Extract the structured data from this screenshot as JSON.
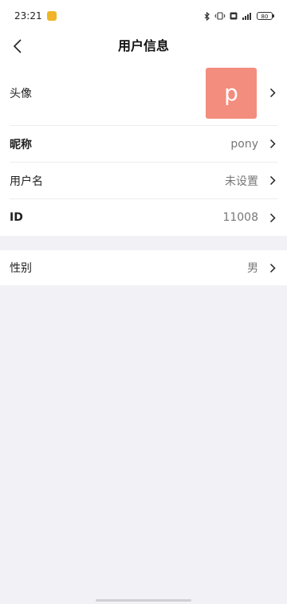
{
  "status_bar": {
    "time": "23:21",
    "notification_icon": "app-notification-icon",
    "battery": "80",
    "icons": [
      "bluetooth-icon",
      "vibrate-icon",
      "hd-icon",
      "signal-icon",
      "battery-icon"
    ]
  },
  "header": {
    "title": "用户信息",
    "back_icon": "chevron-left-icon"
  },
  "profile": {
    "avatar_label": "头像",
    "avatar_letter": "p",
    "avatar_color": "#f38d7d",
    "nickname_label": "昵称",
    "nickname_value": "pony",
    "username_label": "用户名",
    "username_value": "未设置",
    "id_label": "ID",
    "id_value": "11008",
    "gender_label": "性别",
    "gender_value": "男"
  },
  "colors": {
    "background": "#f2f1f6",
    "surface": "#ffffff"
  }
}
